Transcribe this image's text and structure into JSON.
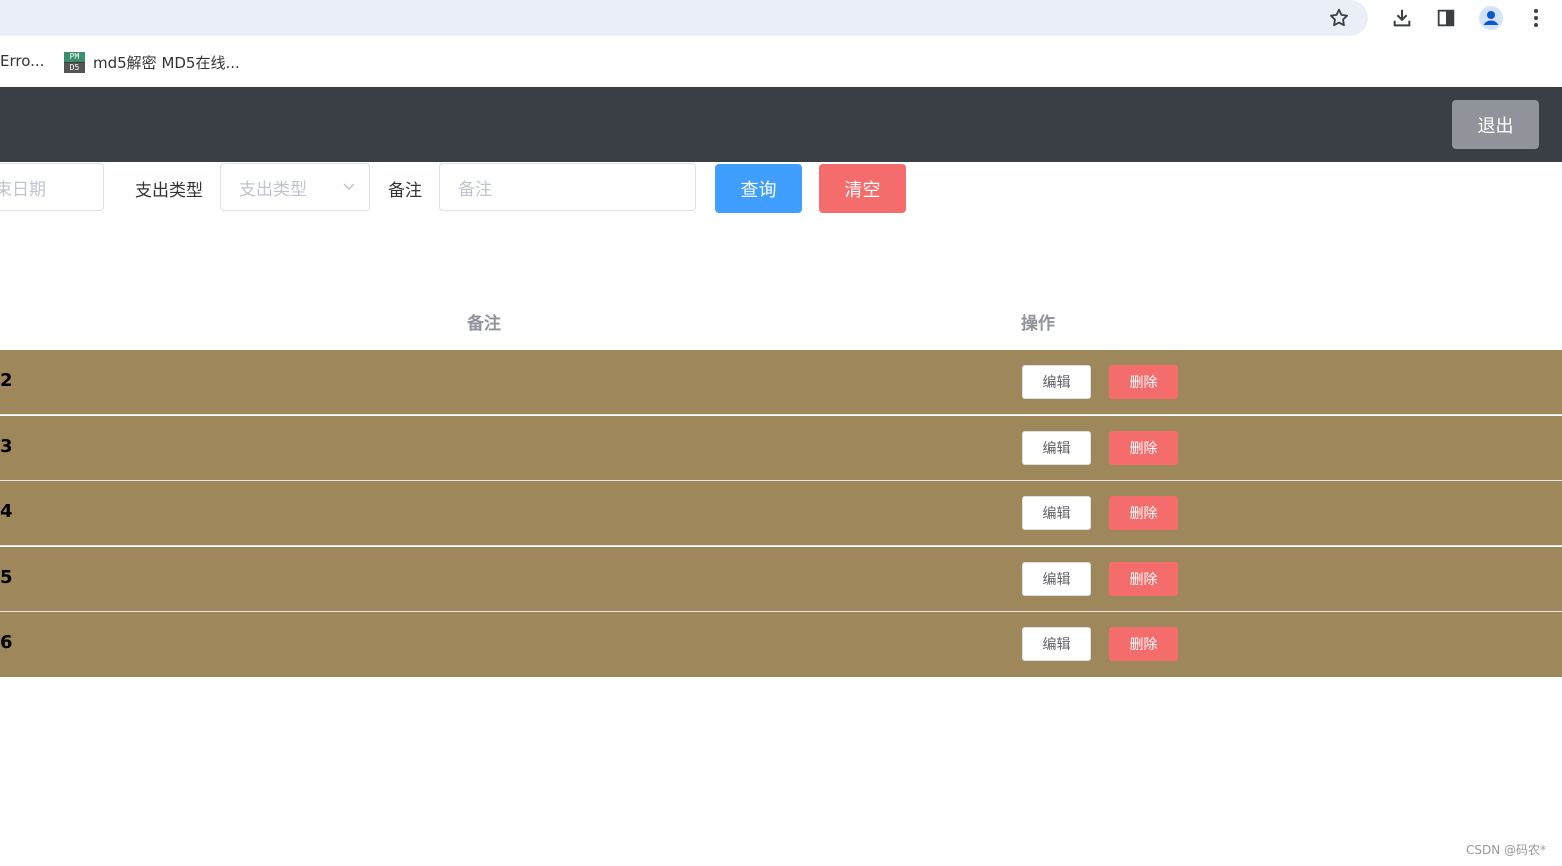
{
  "browser": {
    "bookmarks": [
      "Erro...",
      "md5解密 MD5在线..."
    ],
    "favicon_text_top": "PM",
    "favicon_text_bottom": "D5"
  },
  "header": {
    "logout_label": "退出"
  },
  "filters": {
    "end_date_placeholder": "束日期",
    "expense_type_label": "支出类型",
    "expense_type_placeholder": "支出类型",
    "remark_label": "备注",
    "remark_placeholder": "备注",
    "search_label": "查询",
    "clear_label": "清空"
  },
  "table": {
    "headers": {
      "remark": "备注",
      "actions": "操作"
    },
    "rows": [
      {
        "id": "2",
        "edit": "编辑",
        "delete": "删除"
      },
      {
        "id": "3",
        "edit": "编辑",
        "delete": "删除"
      },
      {
        "id": "4",
        "edit": "编辑",
        "delete": "删除"
      },
      {
        "id": "5",
        "edit": "编辑",
        "delete": "删除"
      },
      {
        "id": "6",
        "edit": "编辑",
        "delete": "删除"
      }
    ]
  },
  "watermark": "CSDN @码农*",
  "colors": {
    "header_bg": "#393f45",
    "row_bg": "#9e885b",
    "primary": "#409eff",
    "danger": "#f56c6c",
    "info": "#909399"
  }
}
